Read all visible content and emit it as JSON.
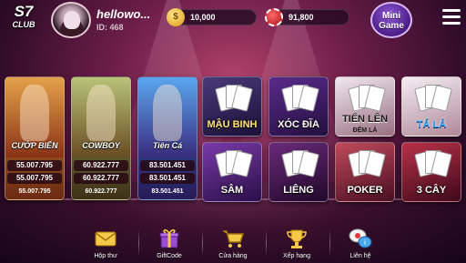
{
  "header": {
    "logo_main": "S7",
    "logo_sub": "CLUB",
    "username": "hellowo...",
    "user_id": "ID: 468",
    "gold_balance": "10,000",
    "chip_balance": "91,800",
    "minigame_label_line1": "Mini",
    "minigame_label_line2": "Game"
  },
  "slots": [
    {
      "name": "CƯỚP BIỂN",
      "jackpots": [
        "55.007.795",
        "55.007.795",
        "55.007.795"
      ]
    },
    {
      "name": "COWBOY",
      "jackpots": [
        "60.922.777",
        "60.922.777",
        "60.922.777"
      ]
    },
    {
      "name": "Tiên Cá",
      "jackpots": [
        "83.501.451",
        "83.501.451",
        "83.501.451"
      ]
    }
  ],
  "games": [
    {
      "label": "MẬU BINH",
      "sub": ""
    },
    {
      "label": "XÓC ĐĨA",
      "sub": ""
    },
    {
      "label": "TIẾN LÊN",
      "sub": "ĐẾM LÁ"
    },
    {
      "label": "TÁ LẢ",
      "sub": ""
    },
    {
      "label": "SÂM",
      "sub": ""
    },
    {
      "label": "LIÊNG",
      "sub": ""
    },
    {
      "label": "POKER",
      "sub": ""
    },
    {
      "label": "3 CÂY",
      "sub": ""
    }
  ],
  "nav": [
    {
      "label": "Hộp thư",
      "icon": "mail-icon"
    },
    {
      "label": "GiftCode",
      "icon": "gift-icon"
    },
    {
      "label": "Cửa hàng",
      "icon": "cart-icon"
    },
    {
      "label": "Xếp hạng",
      "icon": "trophy-icon"
    },
    {
      "label": "Liên hệ",
      "icon": "chat-icon"
    }
  ],
  "colors": {
    "accent_gold": "#f2c230",
    "nav_icon": "#f4c94a",
    "background": "#6a1d48"
  }
}
